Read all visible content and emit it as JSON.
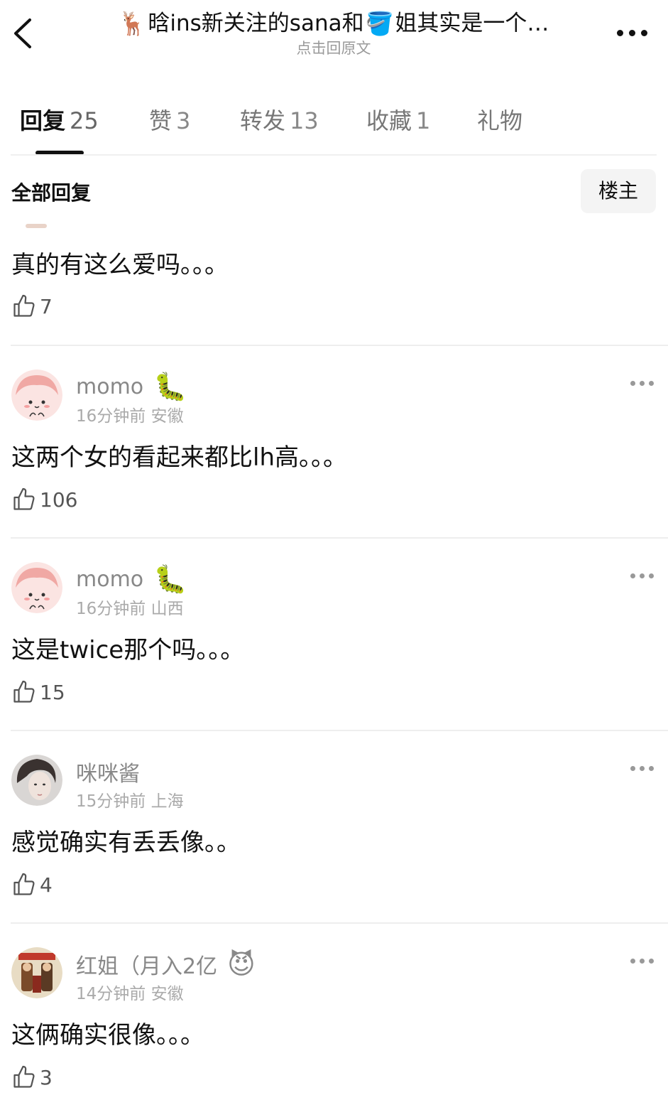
{
  "header": {
    "title_prefix_emoji": "🦌",
    "title_part1": "晗ins新关注的sana和",
    "title_mid_emoji": "🪣",
    "title_part2": "姐其实是一个…",
    "subtitle": "点击回原文"
  },
  "tabs": [
    {
      "label": "回复",
      "count": "25",
      "active": true
    },
    {
      "label": "赞",
      "count": "3"
    },
    {
      "label": "转发",
      "count": "13"
    },
    {
      "label": "收藏",
      "count": "1"
    },
    {
      "label": "礼物",
      "count": ""
    }
  ],
  "filter": {
    "label": "全部回复",
    "op_button": "楼主"
  },
  "comments": [
    {
      "text": "真的有这么爱吗。。。",
      "likes": "7"
    },
    {
      "user": "momo",
      "badge_icon": "caterpillar-sticker",
      "badge": "🐛",
      "time": "16分钟前",
      "location": "安徽",
      "text": "这两个女的看起来都比lh高。。。",
      "likes": "106"
    },
    {
      "user": "momo",
      "badge_icon": "caterpillar-sticker",
      "badge": "🐛",
      "time": "16分钟前",
      "location": "山西",
      "text": "这是twice那个吗。。。",
      "likes": "15"
    },
    {
      "user": "咪咪酱",
      "time": "15分钟前",
      "location": "上海",
      "text": "感觉确实有丢丢像。。",
      "likes": "4"
    },
    {
      "user": "红姐（月入2亿",
      "badge_icon": "nezha-sticker",
      "badge": "😈",
      "time": "14分钟前",
      "location": "安徽",
      "text": "这俩确实很像。。。",
      "likes": "3"
    }
  ],
  "colors": {
    "text_primary": "#111111",
    "text_secondary": "#888888",
    "divider": "#eeeeee",
    "chip_bg": "#f4f4f4"
  }
}
